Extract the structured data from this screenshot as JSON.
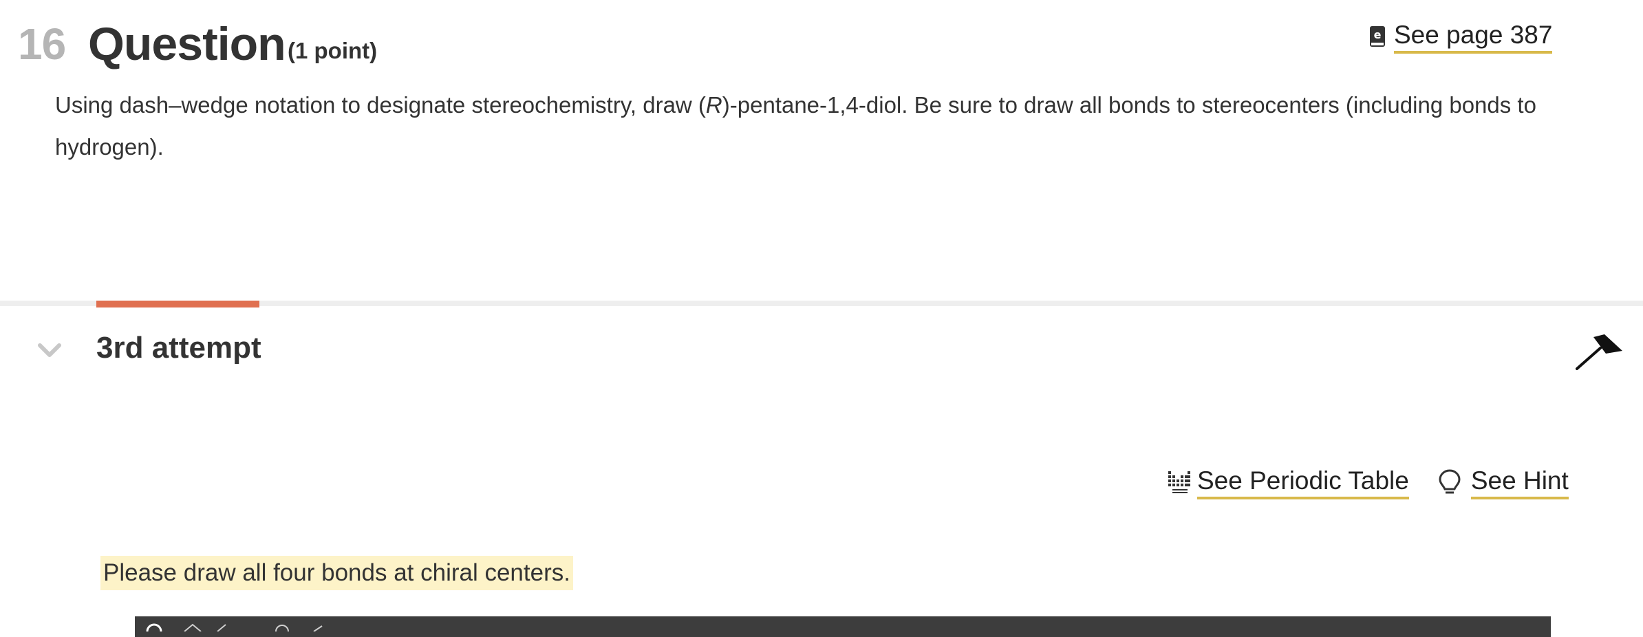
{
  "question": {
    "number": "16",
    "title": "Question",
    "points": "(1 point)",
    "see_page_label": "See page 387",
    "prompt_before_italic": "Using dash–wedge notation to designate stereochemistry, draw (",
    "prompt_italic": "R",
    "prompt_after_italic": ")-pentane-1,4-diol. Be sure to draw all bonds to stereocenters (including bonds to hydrogen)."
  },
  "attempt": {
    "label": "3rd attempt"
  },
  "tools": {
    "periodic_table_label": "See Periodic Table",
    "hint_label": "See Hint"
  },
  "notice": {
    "text": "Please draw all four bonds at chiral centers."
  },
  "icons": {
    "ebook": "ebook-icon",
    "chevron": "chevron-down-icon",
    "flag": "flag-icon",
    "periodic": "periodic-table-icon",
    "hint": "lightbulb-icon"
  },
  "colors": {
    "active_tab": "#e07050",
    "link_underline": "#d8b94a",
    "notice_background": "#fdf3c8",
    "question_number": "#b5b5b5",
    "editor_toolbar": "#3d3d3d"
  }
}
